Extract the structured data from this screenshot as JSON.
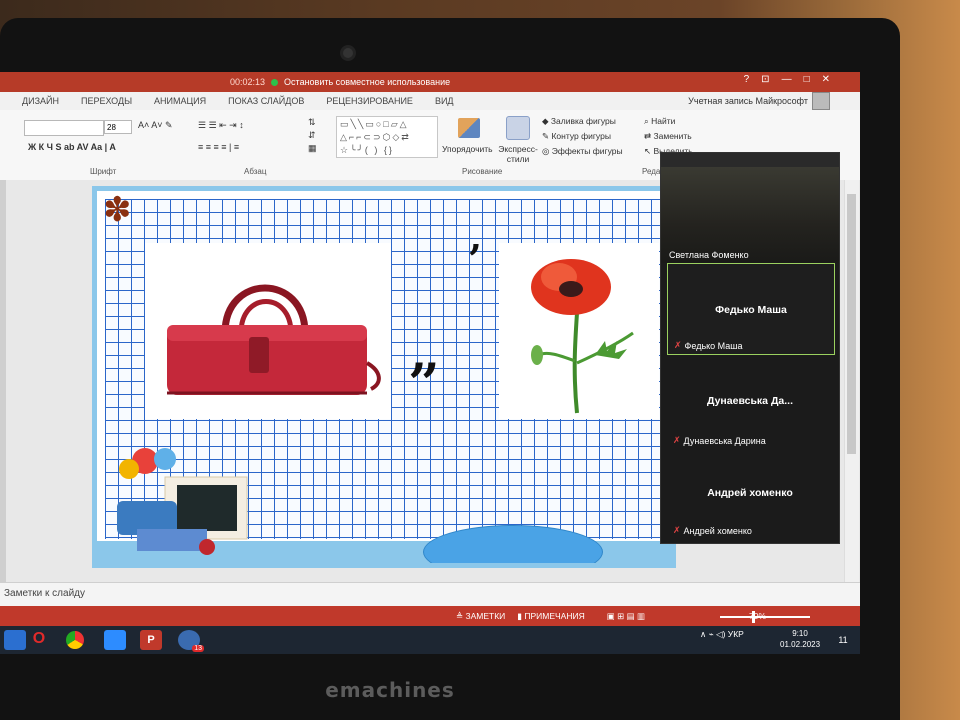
{
  "zoom_bar": {
    "timer": "00:02:13",
    "stop_share": "Остановить совместное использование"
  },
  "window_controls": [
    "?",
    "⊡",
    "—",
    "□",
    "✕"
  ],
  "account": "Учетная запись Майкрософт",
  "tabs": [
    "ДИЗАЙН",
    "ПЕРЕХОДЫ",
    "АНИМАЦИЯ",
    "ПОКАЗ СЛАЙДОВ",
    "РЕЦЕНЗИРОВАНИЕ",
    "ВИД"
  ],
  "ribbon": {
    "font_size": "28",
    "group_font": "Шрифт",
    "group_paragraph": "Абзац",
    "group_drawing": "Рисование",
    "group_edit": "Реда",
    "arrange": "Упорядочить",
    "express_styles": "Экспресс-стили",
    "shape_fill": "Заливка фигуры",
    "shape_outline": "Контур фигуры",
    "shape_effects": "Эффекты фигуры",
    "find": "Найти",
    "replace": "Заменить",
    "select": "Выделить"
  },
  "slide": {
    "comma_top": "ʼ",
    "commas_mid": "ʼʼ"
  },
  "notes_placeholder": "Заметки к слайду",
  "status": {
    "notes": "ЗАМЕТКИ",
    "comments": "ПРИМЕЧАНИЯ",
    "zoom": "70%"
  },
  "taskbar": {
    "lang": "УКР",
    "time": "9:10",
    "date": "01.02.2023",
    "badge": "13",
    "notif": "11"
  },
  "zoom_panel": {
    "video_name": "Светлана Фоменко",
    "tiles": [
      {
        "title": "Федько Маша",
        "label": "Федько Маша"
      },
      {
        "title": "Дунаевськa Да...",
        "label": "Дунаевськa Дарина"
      },
      {
        "title": "Андрей хоменко",
        "label": "Андрей хоменко"
      }
    ]
  },
  "brand": "emachines",
  "colors": {
    "accent": "#c0392b",
    "grid": "#2b66c9",
    "oval": "#4aa3e6"
  }
}
